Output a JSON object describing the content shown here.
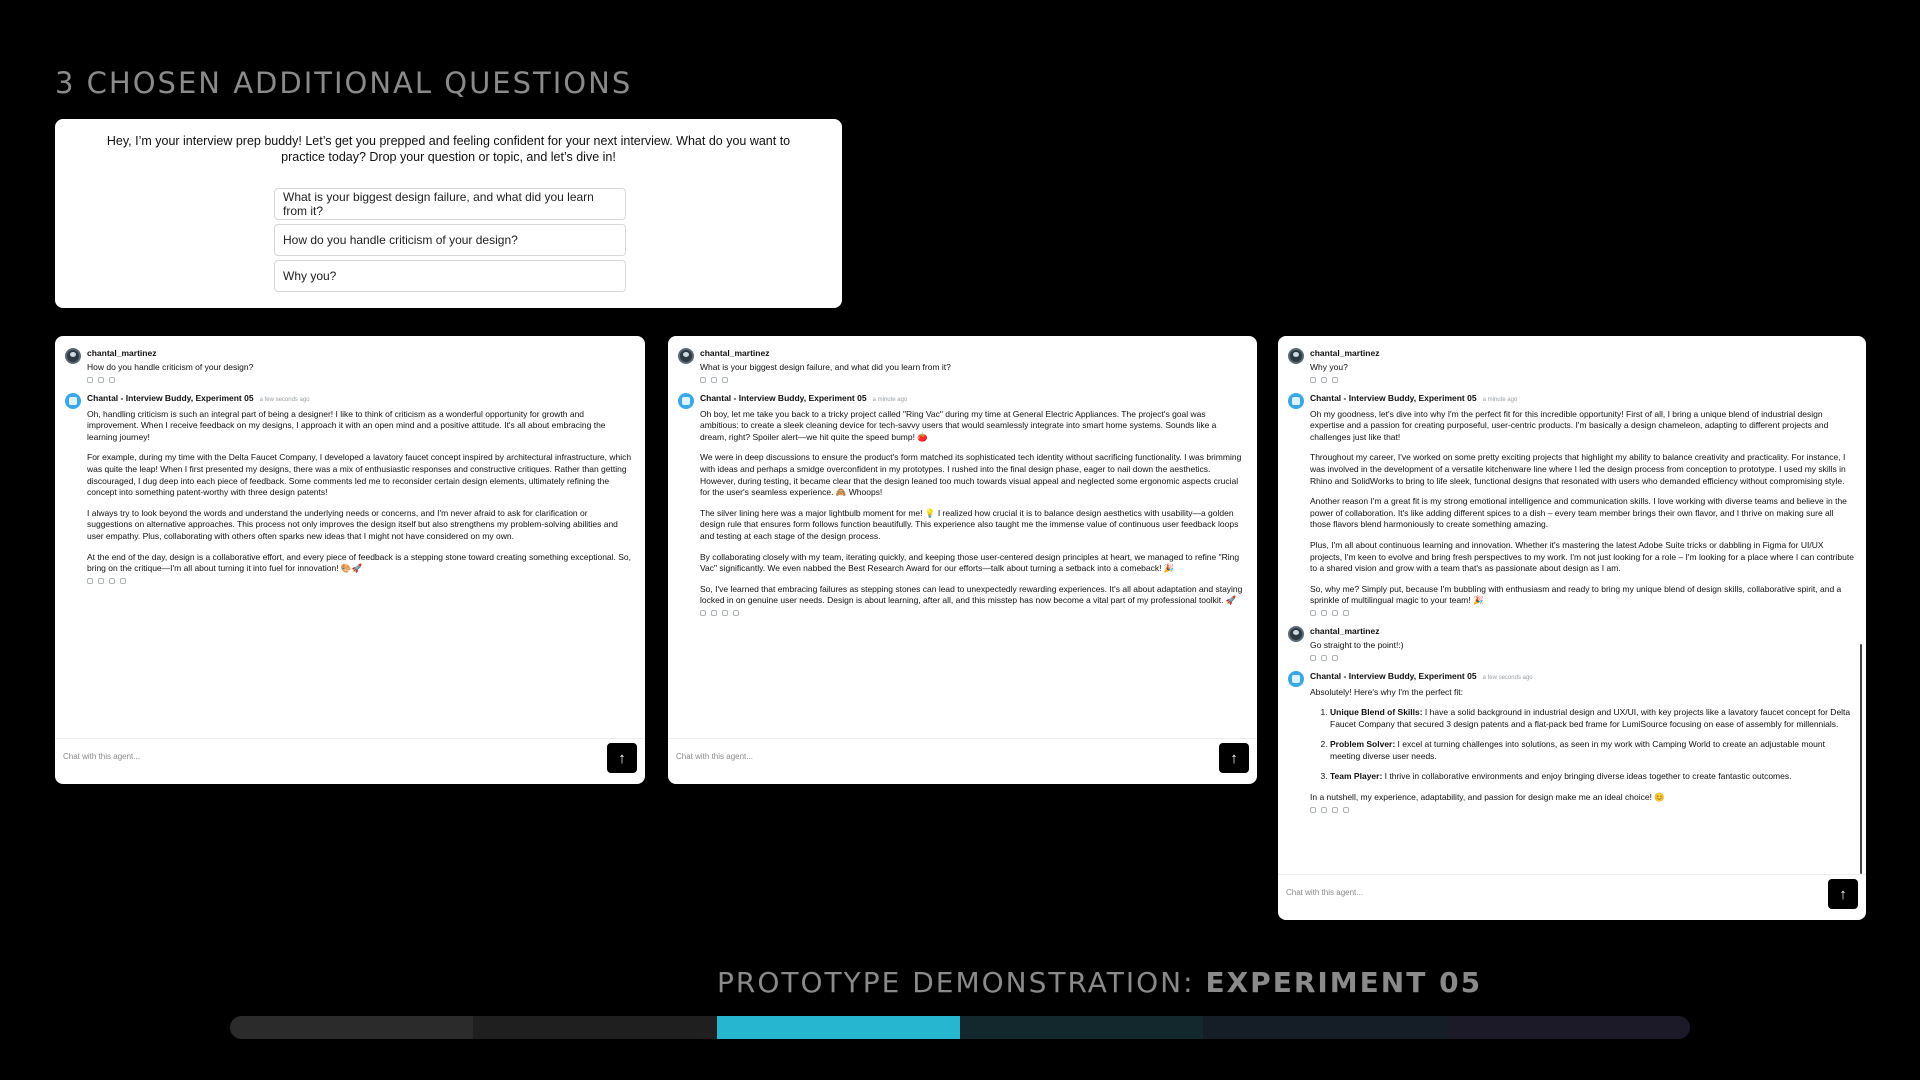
{
  "section_title": "3 CHOSEN ADDITIONAL QUESTIONS",
  "intro": {
    "text": "Hey, I’m your interview prep buddy! Let’s get you prepped and feeling confident for your next interview. What do you want to practice today? Drop your question or topic, and let’s dive in!",
    "suggestions": [
      "What is your biggest design failure, and what did you learn from it?",
      "How do you handle criticism of your design?",
      "Why you?"
    ]
  },
  "composer": {
    "placeholder": "Chat with this agent...",
    "send_icon": "arrow-up-icon"
  },
  "panels": [
    {
      "user_name": "chantal_martinez",
      "user_question": "How do you handle criticism of your design?",
      "bot_name": "Chantal - Interview Buddy, Experiment 05",
      "bot_time": "a few seconds ago",
      "paragraphs": [
        "Oh, handling criticism is such an integral part of being a designer! I like to think of criticism as a wonderful opportunity for growth and improvement. When I receive feedback on my designs, I approach it with an open mind and a positive attitude. It's all about embracing the learning journey!",
        "For example, during my time with the Delta Faucet Company, I developed a lavatory faucet concept inspired by architectural infrastructure, which was quite the leap! When I first presented my designs, there was a mix of enthusiastic responses and constructive critiques. Rather than getting discouraged, I dug deep into each piece of feedback. Some comments led me to reconsider certain design elements, ultimately refining the concept into something patent-worthy with three design patents!",
        "I always try to look beyond the words and understand the underlying needs or concerns, and I'm never afraid to ask for clarification or suggestions on alternative approaches. This process not only improves the design itself but also strengthens my problem-solving abilities and user empathy. Plus, collaborating with others often sparks new ideas that I might not have considered on my own.",
        "At the end of the day, design is a collaborative effort, and every piece of feedback is a stepping stone toward creating something exceptional. So, bring on the critique—I'm all about turning it into fuel for innovation! 🎨🚀"
      ]
    },
    {
      "user_name": "chantal_martinez",
      "user_question": "What is your biggest design failure, and what did you learn from it?",
      "bot_name": "Chantal - Interview Buddy, Experiment 05",
      "bot_time": "a minute ago",
      "paragraphs": [
        "Oh boy, let me take you back to a tricky project called \"Ring Vac\" during my time at General Electric Appliances. The project's goal was ambitious: to create a sleek cleaning device for tech-savvy users that would seamlessly integrate into smart home systems. Sounds like a dream, right? Spoiler alert—we hit quite the speed bump! 🍅",
        "We were in deep discussions to ensure the product's form matched its sophisticated tech identity without sacrificing functionality. I was brimming with ideas and perhaps a smidge overconfident in my prototypes. I rushed into the final design phase, eager to nail down the aesthetics. However, during testing, it became clear that the design leaned too much towards visual appeal and neglected some ergonomic aspects crucial for the user's seamless experience. 🙈 Whoops!",
        "The silver lining here was a major lightbulb moment for me! 💡 I realized how crucial it is to balance design aesthetics with usability—a golden design rule that ensures form follows function beautifully. This experience also taught me the immense value of continuous user feedback loops and testing at each stage of the design process.",
        "By collaborating closely with my team, iterating quickly, and keeping those user-centered design principles at heart, we managed to refine \"Ring Vac\" significantly. We even nabbed the Best Research Award for our efforts—talk about turning a setback into a comeback! 🎉",
        "So, I've learned that embracing failures as stepping stones can lead to unexpectedly rewarding experiences. It's all about adaptation and staying locked in on genuine user needs. Design is about learning, after all, and this misstep has now become a vital part of my professional toolkit. 🚀"
      ]
    },
    {
      "user_name": "chantal_martinez",
      "user_question": "Why you?",
      "bot_name": "Chantal - Interview Buddy, Experiment 05",
      "bot_time": "a minute ago",
      "paragraphs": [
        "Oh my goodness, let's dive into why I'm the perfect fit for this incredible opportunity! First of all, I bring a unique blend of industrial design expertise and a passion for creating purposeful, user-centric products. I'm basically a design chameleon, adapting to different projects and challenges just like that!",
        "Throughout my career, I've worked on some pretty exciting projects that highlight my ability to balance creativity and practicality. For instance, I was involved in the development of a versatile kitchenware line where I led the design process from conception to prototype. I used my skills in Rhino and SolidWorks to bring to life sleek, functional designs that resonated with users who demanded efficiency without compromising style.",
        "Another reason I'm a great fit is my strong emotional intelligence and communication skills. I love working with diverse teams and believe in the power of collaboration. It's like adding different spices to a dish – every team member brings their own flavor, and I thrive on making sure all those flavors blend harmoniously to create something amazing.",
        "Plus, I'm all about continuous learning and innovation. Whether it's mastering the latest Adobe Suite tricks or dabbling in Figma for UI/UX projects, I'm keen to evolve and bring fresh perspectives to my work. I'm not just looking for a role – I'm looking for a place where I can contribute to a shared vision and grow with a team that's as passionate about design as I am.",
        "So, why me? Simply put, because I'm bubbling with enthusiasm and ready to bring my unique blend of design skills, collaborative spirit, and a sprinkle of multilingual magic to your team! 🎉"
      ],
      "followup_user": "chantal_martinez",
      "followup_question": "Go straight to the point!:)",
      "followup_bot_name": "Chantal - Interview Buddy, Experiment 05",
      "followup_time": "a few seconds ago",
      "followup_intro": "Absolutely! Here's why I'm the perfect fit:",
      "followup_points": [
        {
          "label": "Unique Blend of Skills:",
          "text": " I have a solid background in industrial design and UX/UI, with key projects like a lavatory faucet concept for Delta Faucet Company that secured 3 design patents and a flat-pack bed frame for LumiSource focusing on ease of assembly for millennials."
        },
        {
          "label": "Problem Solver:",
          "text": " I excel at turning challenges into solutions, as seen in my work with Camping World to create an adjustable mount meeting diverse user needs."
        },
        {
          "label": "Team Player:",
          "text": " I thrive in collaborative environments and enjoy bringing diverse ideas together to create fantastic outcomes."
        }
      ],
      "followup_outro": "In a nutshell, my experience, adaptability, and passion for design make me an ideal choice! 😊"
    }
  ],
  "footer": {
    "title_prefix": "PROTOTYPE DEMONSTRATION: ",
    "title_bold": "EXPERIMENT 05",
    "progress": {
      "segments": 6,
      "active_index": 2
    },
    "colors": [
      "#2b2b2b",
      "#1f1f1f",
      "#27b6cf",
      "#12282c",
      "#151d26",
      "#1c1a28"
    ]
  }
}
